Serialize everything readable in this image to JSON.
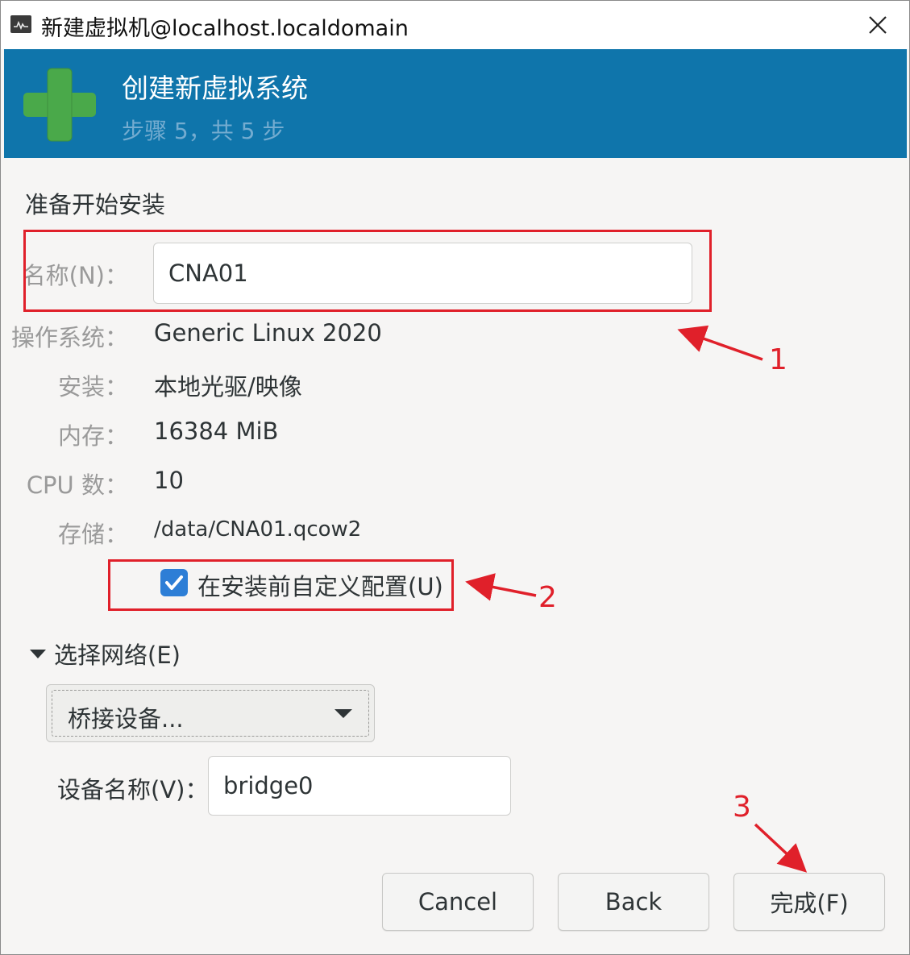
{
  "window": {
    "title": "新建虚拟机@localhost.localdomain",
    "app_icon": "virt-manager-icon",
    "close_icon": "close-icon"
  },
  "banner": {
    "title": "创建新虚拟系统",
    "step": "步骤 5，共 5 步",
    "icon": "plus-icon",
    "background_color": "#0f75ab"
  },
  "form": {
    "heading": "准备开始安装",
    "name_label": "名称(N)：",
    "name_value": "CNA01",
    "os_label": "操作系统：",
    "os_value": "Generic Linux 2020",
    "install_label": "安装：",
    "install_value": "本地光驱/映像",
    "memory_label": "内存：",
    "memory_value": "16384 MiB",
    "cpu_label": "CPU 数：",
    "cpu_value": "10",
    "storage_label": "存储：",
    "storage_value": "/data/CNA01.qcow2",
    "customize_label": "在安装前自定义配置(U)",
    "customize_checked": true
  },
  "network": {
    "expander_label": "选择网络(E)",
    "source_selected": "桥接设备...",
    "device_label": "设备名称(V)：",
    "device_value": "bridge0"
  },
  "buttons": {
    "cancel": "Cancel",
    "back": "Back",
    "finish": "完成(F)"
  },
  "annotations": {
    "n1": "1",
    "n2": "2",
    "n3": "3",
    "color": "#e0202a"
  }
}
